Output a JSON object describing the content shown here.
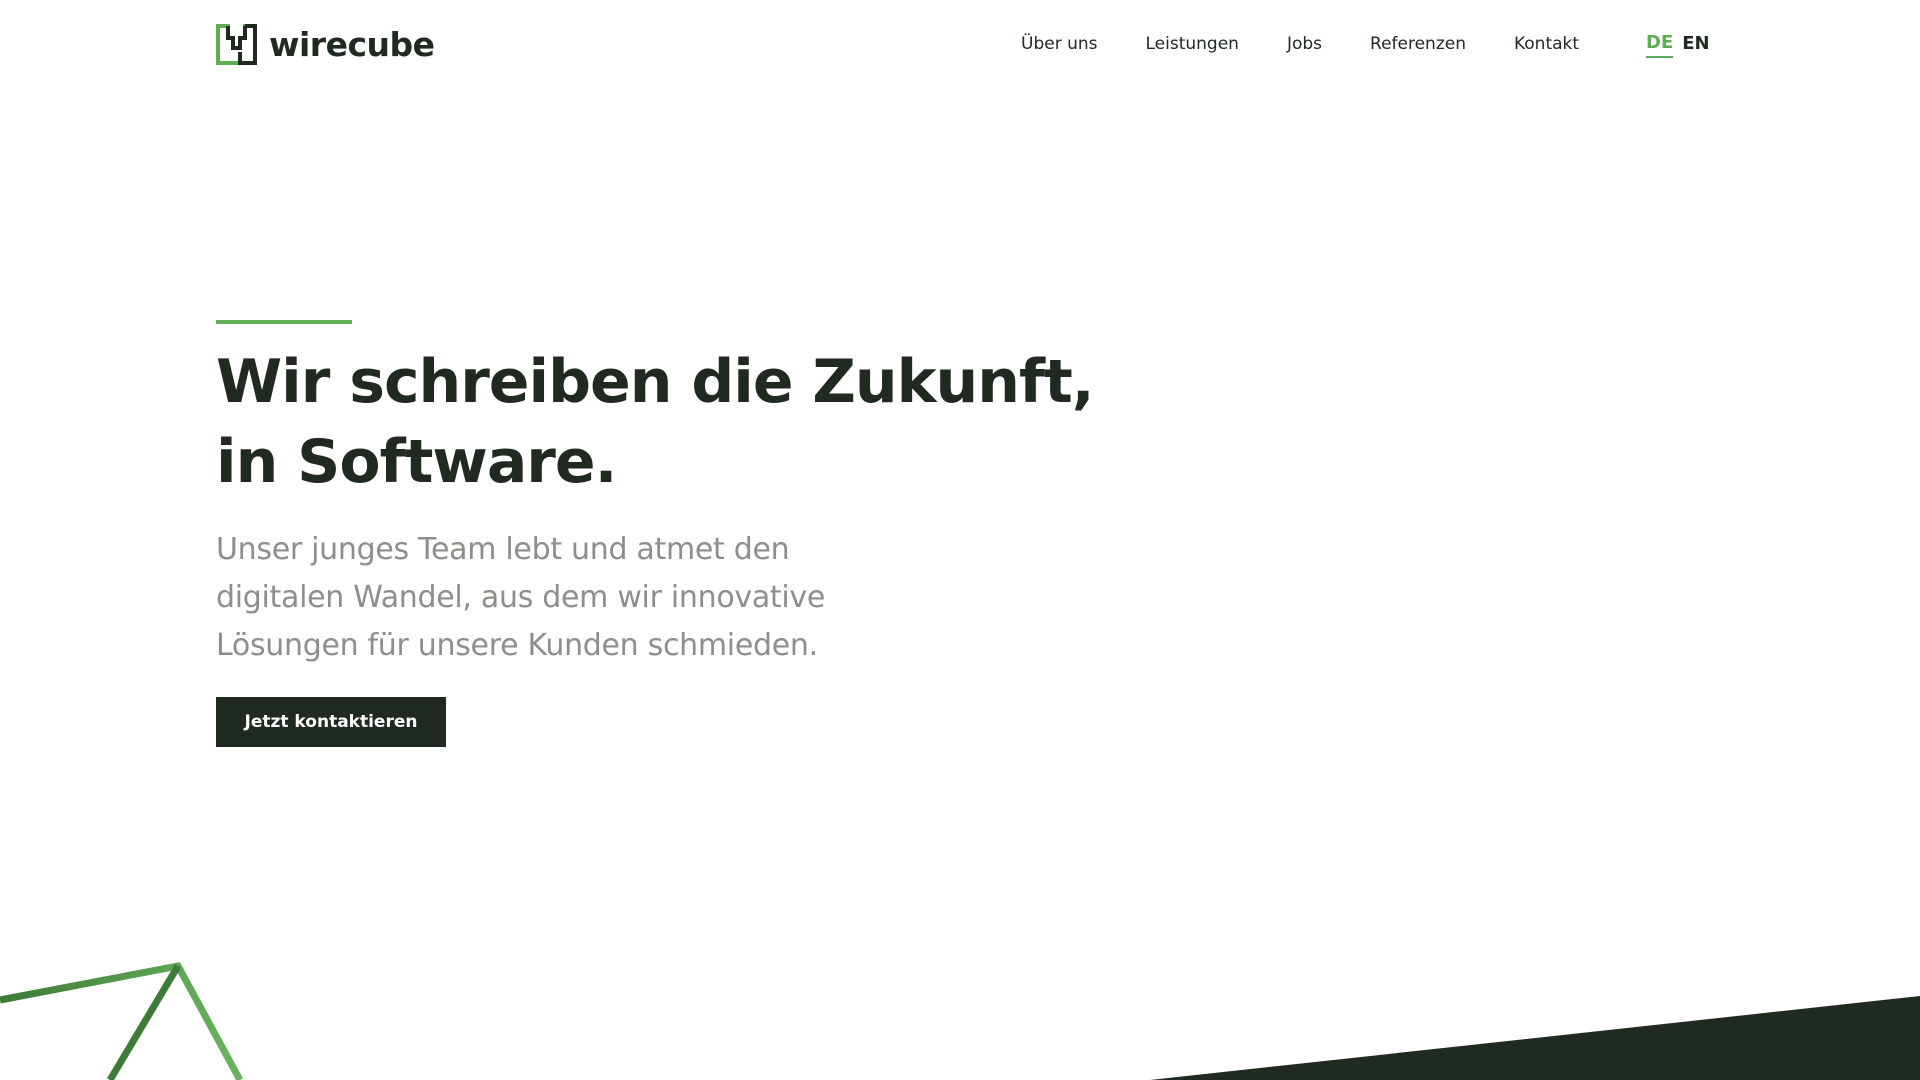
{
  "brand": {
    "name": "wirecube",
    "accent_color": "#5fae55",
    "dark_color": "#212a20",
    "muted_text_color": "#8c8f8a"
  },
  "nav": {
    "items": [
      {
        "label": "Über uns"
      },
      {
        "label": "Leistungen"
      },
      {
        "label": "Jobs"
      },
      {
        "label": "Referenzen"
      },
      {
        "label": "Kontakt"
      }
    ]
  },
  "language": {
    "options": [
      {
        "label": "DE",
        "active": true
      },
      {
        "label": "EN",
        "active": false
      }
    ]
  },
  "hero": {
    "title": "Wir schreiben die Zukunft, in Software.",
    "subtitle": "Unser junges Team lebt und atmet den digitalen Wandel, aus dem wir innovative Lösungen für unsere Kunden schmieden.",
    "cta_label": "Jetzt kontaktieren"
  },
  "icons": {
    "logo": "wirecube-logo-icon",
    "decoration_left": "green-triangle-outline",
    "decoration_right": "dark-sloped-band"
  }
}
